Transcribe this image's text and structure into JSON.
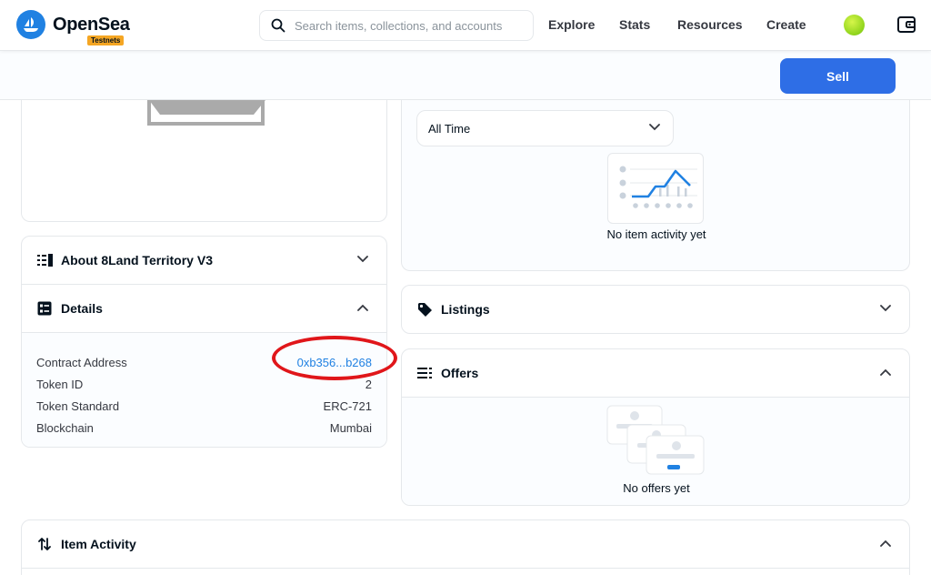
{
  "header": {
    "brand": "OpenSea",
    "badge": "Testnets",
    "search_placeholder": "Search items, collections, and accounts",
    "nav": [
      "Explore",
      "Stats",
      "Resources",
      "Create"
    ]
  },
  "toolbar": {
    "sell_label": "Sell"
  },
  "about": {
    "title": "About 8Land Territory V3"
  },
  "details": {
    "title": "Details",
    "rows": [
      {
        "label": "Contract Address",
        "value": "0xb356...b268"
      },
      {
        "label": "Token ID",
        "value": "2"
      },
      {
        "label": "Token Standard",
        "value": "ERC-721"
      },
      {
        "label": "Blockchain",
        "value": "Mumbai"
      }
    ]
  },
  "price_history": {
    "period": "All Time",
    "empty_text": "No item activity yet"
  },
  "listings": {
    "title": "Listings"
  },
  "offers": {
    "title": "Offers",
    "empty_text": "No offers yet"
  },
  "item_activity": {
    "title": "Item Activity"
  },
  "colors": {
    "accent": "#2081e2",
    "sell_button": "#2e6ee6",
    "highlight": "#e0161a",
    "badge": "#f5a623"
  },
  "icons": [
    "search-icon",
    "wallet-icon",
    "list-icon",
    "details-icon",
    "tag-icon",
    "offers-icon",
    "swap-arrows-icon",
    "chevron-down-icon",
    "chevron-up-icon"
  ]
}
